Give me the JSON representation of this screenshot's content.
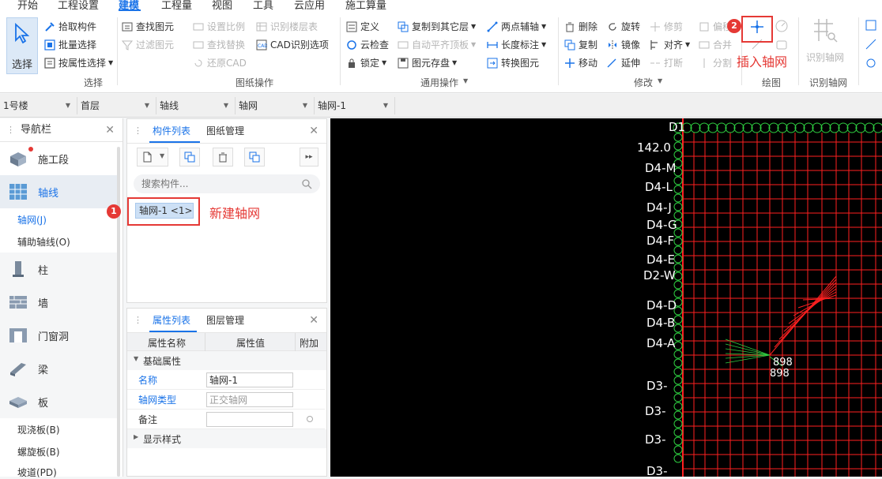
{
  "menu": {
    "items": [
      "开始",
      "工程设置",
      "建模",
      "工程量",
      "视图",
      "工具",
      "云应用",
      "施工算量"
    ],
    "active_index": 2
  },
  "ribbon": {
    "select": {
      "label": "选择",
      "pick": "拾取构件",
      "batch": "批量选择",
      "by_attr": "按属性选择",
      "group": "选择"
    },
    "drawing_ops": {
      "find_elem": "查找图元",
      "filter_elem": "过滤图元",
      "set_scale": "设置比例",
      "find_replace": "查找替换",
      "restore_cad": "还原CAD",
      "recognize_floor": "识别楼层表",
      "cad_options": "CAD识别选项",
      "group": "图纸操作"
    },
    "general_ops": {
      "define": "定义",
      "cloud_check": "云检查",
      "lock": "锁定",
      "copy_to_layer": "复制到其它层",
      "auto_flat_top": "自动平齐顶板",
      "elem_save": "图元存盘",
      "two_point_axis": "两点辅轴",
      "length_mark": "长度标注",
      "convert_elem": "转换图元",
      "group": "通用操作"
    },
    "modify": {
      "delete": "删除",
      "rotate": "旋转",
      "trim": "修剪",
      "offset": "偏移",
      "copy": "复制",
      "mirror": "镜像",
      "align": "对齐",
      "merge": "合并",
      "move": "移动",
      "extend": "延伸",
      "break": "打断",
      "split": "分割",
      "group": "修改"
    },
    "draw": {
      "group": "绘图"
    },
    "recognize": {
      "label": "识别轴网",
      "group": "识别轴网"
    }
  },
  "toolbar": {
    "floor_building": "1号楼",
    "floor": "首层",
    "category": "轴线",
    "type": "轴网",
    "component": "轴网-1"
  },
  "nav": {
    "title": "导航栏",
    "items": [
      "施工段",
      "轴线",
      "柱",
      "墙",
      "门窗洞",
      "梁",
      "板"
    ],
    "subitems": [
      "轴网(J)",
      "辅助轴线(O)"
    ],
    "board_subitems": [
      "现浇板(B)",
      "螺旋板(B)",
      "坡道(PD)"
    ]
  },
  "component_panel": {
    "tab_active": "构件列表",
    "tab_other": "图纸管理",
    "search_placeholder": "搜索构件...",
    "item": "轴网-1 <1>"
  },
  "property_panel": {
    "tab_active": "属性列表",
    "tab_other": "图层管理",
    "headers": [
      "属性名称",
      "属性值",
      "附加"
    ],
    "section_basic": "基础属性",
    "rows": [
      {
        "key": "名称",
        "value": "轴网-1"
      },
      {
        "key": "轴网类型",
        "value": "正交轴网"
      },
      {
        "key": "备注",
        "value": ""
      }
    ],
    "section_display": "显示样式"
  },
  "annotations": {
    "badge1": "1",
    "badge2": "2",
    "text1": "新建轴网",
    "text2": "插入轴网"
  },
  "canvas": {
    "labels": [
      "D1",
      "142.0",
      "D4-M",
      "D4-L",
      "D4-J",
      "D4-G",
      "D4-F",
      "D4-E",
      "D2-W",
      "D4-D",
      "D4-B",
      "D4-A",
      "D3-",
      "D3-",
      "D3-",
      "D3-"
    ],
    "numbers": [
      "898",
      "898"
    ]
  },
  "colors": {
    "accent": "#1a73e8",
    "annotation_red": "#e53935",
    "grid_red": "#ff2020",
    "grid_green": "#2ecc40"
  }
}
